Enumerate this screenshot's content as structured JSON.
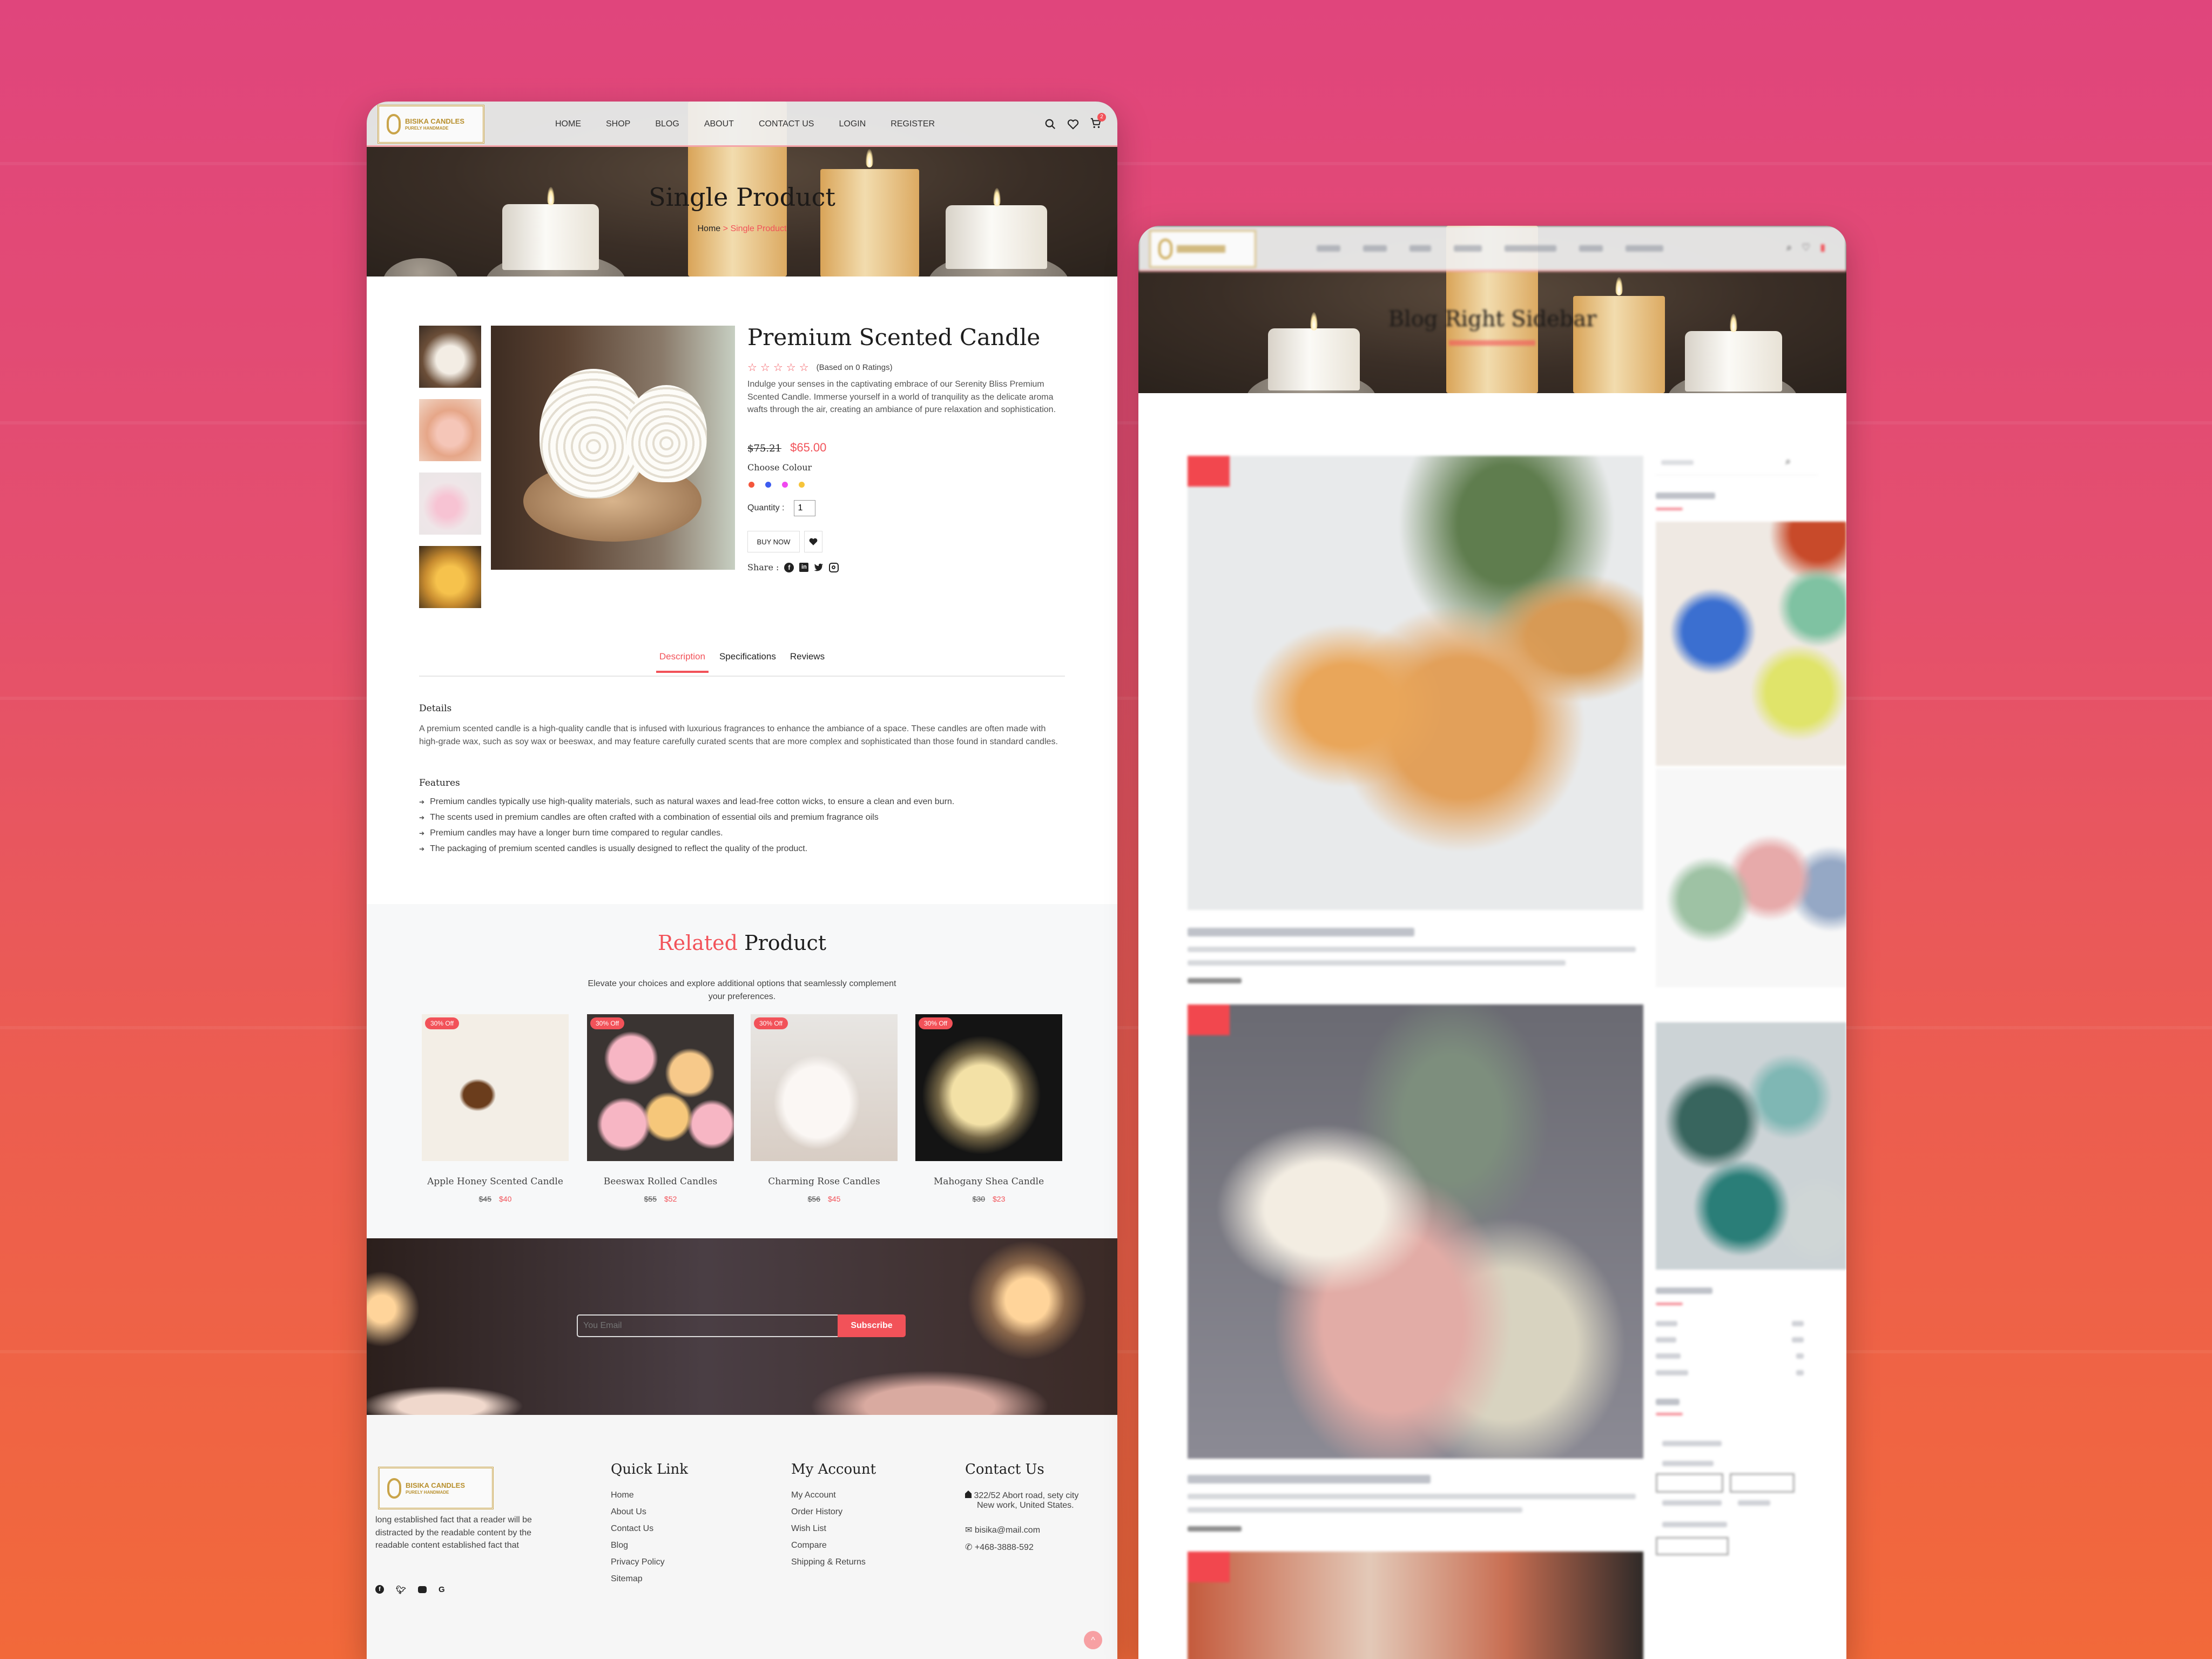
{
  "colors": {
    "accent": "#f25259",
    "gold": "#c9a44a",
    "bg_top": "#e0457c",
    "bg_bottom": "#f2693a"
  },
  "product_page": {
    "logo": {
      "name": "BISIKA CANDLES",
      "tagline": "PURELY HANDMADE"
    },
    "nav": [
      "HOME",
      "SHOP",
      "BLOG",
      "ABOUT",
      "CONTACT US",
      "LOGIN",
      "REGISTER"
    ],
    "header_icons": [
      "search-icon",
      "heart-icon",
      "cart-icon"
    ],
    "cart_count": "2",
    "hero": {
      "title": "Single Product",
      "breadcrumb_home": "Home",
      "breadcrumb_sep": ">",
      "breadcrumb_current": "Single Product"
    },
    "product": {
      "title": "Premium Scented Candle",
      "rating_stars": 0,
      "rating_text": "(Based on 0 Ratings)",
      "description": "Indulge your senses in the captivating embrace of our Serenity Bliss Premium Scented Candle. Immerse yourself in a world of tranquility as the delicate aroma wafts through the air, creating an ambiance of pure relaxation and sophistication.",
      "old_price": "$75.21",
      "price": "$65.00",
      "colour_label": "Choose Colour",
      "colours": [
        "#f4563c",
        "#3d5cf0",
        "#f048f0",
        "#f6c43a"
      ],
      "quantity_label": "Quantity :",
      "quantity": "1",
      "buy_now": "BUY NOW",
      "share_label": "Share :",
      "share_icons": [
        "facebook-icon",
        "linkedin-icon",
        "twitter-icon",
        "instagram-icon"
      ]
    },
    "tabs": [
      {
        "label": "Description",
        "active": true
      },
      {
        "label": "Specifications",
        "active": false
      },
      {
        "label": "Reviews",
        "active": false
      }
    ],
    "details": {
      "heading": "Details",
      "text": "A premium scented candle is a high-quality candle that is infused with luxurious fragrances to enhance the ambiance of a space. These candles are often made with high-grade wax, such as soy wax or beeswax, and may feature carefully curated scents that are more complex and sophisticated than those found in standard candles."
    },
    "features": {
      "heading": "Features",
      "items": [
        "Premium candles typically use high-quality materials, such as natural waxes and lead-free cotton wicks, to ensure a clean and even burn.",
        "The scents used in premium candles are often crafted with a combination of essential oils and premium fragrance oils",
        "Premium candles may have a longer burn time compared to regular candles.",
        "The packaging of premium scented candles is usually designed to reflect the quality of the product."
      ]
    },
    "related": {
      "title_accent": "Related",
      "title_rest": "Product",
      "subtitle": "Elevate your choices and explore additional options that seamlessly complement your preferences.",
      "items": [
        {
          "badge": "30% Off",
          "name": "Apple Honey Scented Candle",
          "old_price": "$45",
          "price": "$40"
        },
        {
          "badge": "30% Off",
          "name": "Beeswax Rolled Candles",
          "old_price": "$55",
          "price": "$52"
        },
        {
          "badge": "30% Off",
          "name": "Charming Rose Candles",
          "old_price": "$56",
          "price": "$45"
        },
        {
          "badge": "30% Off",
          "name": "Mahogany Shea Candle",
          "old_price": "$30",
          "price": "$23"
        }
      ]
    },
    "newsletter": {
      "placeholder": "You Email",
      "button": "Subscribe"
    },
    "footer": {
      "about": "long established fact that a reader will be distracted by the readable content by the readable content established fact that",
      "social_icons": [
        "facebook-icon",
        "twitter-icon",
        "youtube-icon",
        "google-icon"
      ],
      "quick_link": {
        "heading": "Quick Link",
        "links": [
          "Home",
          "About Us",
          "Contact Us",
          "Blog",
          "Privacy Policy",
          "Sitemap"
        ]
      },
      "my_account": {
        "heading": "My Account",
        "links": [
          "My Account",
          "Order History",
          "Wish List",
          "Compare",
          "Shipping & Returns"
        ]
      },
      "contact": {
        "heading": "Contact Us",
        "address_line1": "322/52 Abort road, sety city",
        "address_line2": "New work, United States.",
        "email": "bisika@mail.com",
        "phone": "+468-3888-592"
      }
    }
  },
  "blog_page": {
    "hero": {
      "title": "Blog Right Sidebar"
    }
  }
}
